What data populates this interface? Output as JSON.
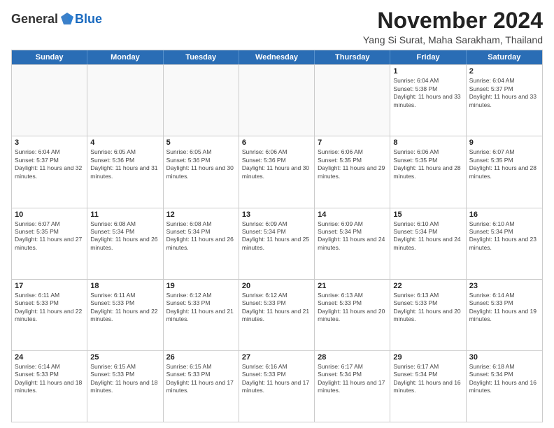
{
  "logo": {
    "general": "General",
    "blue": "Blue"
  },
  "title": "November 2024",
  "subtitle": "Yang Si Surat, Maha Sarakham, Thailand",
  "header_days": [
    "Sunday",
    "Monday",
    "Tuesday",
    "Wednesday",
    "Thursday",
    "Friday",
    "Saturday"
  ],
  "weeks": [
    [
      {
        "day": "",
        "empty": true
      },
      {
        "day": "",
        "empty": true
      },
      {
        "day": "",
        "empty": true
      },
      {
        "day": "",
        "empty": true
      },
      {
        "day": "",
        "empty": true
      },
      {
        "day": "1",
        "sunrise": "Sunrise: 6:04 AM",
        "sunset": "Sunset: 5:38 PM",
        "daylight": "Daylight: 11 hours and 33 minutes."
      },
      {
        "day": "2",
        "sunrise": "Sunrise: 6:04 AM",
        "sunset": "Sunset: 5:37 PM",
        "daylight": "Daylight: 11 hours and 33 minutes."
      }
    ],
    [
      {
        "day": "3",
        "sunrise": "Sunrise: 6:04 AM",
        "sunset": "Sunset: 5:37 PM",
        "daylight": "Daylight: 11 hours and 32 minutes."
      },
      {
        "day": "4",
        "sunrise": "Sunrise: 6:05 AM",
        "sunset": "Sunset: 5:36 PM",
        "daylight": "Daylight: 11 hours and 31 minutes."
      },
      {
        "day": "5",
        "sunrise": "Sunrise: 6:05 AM",
        "sunset": "Sunset: 5:36 PM",
        "daylight": "Daylight: 11 hours and 30 minutes."
      },
      {
        "day": "6",
        "sunrise": "Sunrise: 6:06 AM",
        "sunset": "Sunset: 5:36 PM",
        "daylight": "Daylight: 11 hours and 30 minutes."
      },
      {
        "day": "7",
        "sunrise": "Sunrise: 6:06 AM",
        "sunset": "Sunset: 5:35 PM",
        "daylight": "Daylight: 11 hours and 29 minutes."
      },
      {
        "day": "8",
        "sunrise": "Sunrise: 6:06 AM",
        "sunset": "Sunset: 5:35 PM",
        "daylight": "Daylight: 11 hours and 28 minutes."
      },
      {
        "day": "9",
        "sunrise": "Sunrise: 6:07 AM",
        "sunset": "Sunset: 5:35 PM",
        "daylight": "Daylight: 11 hours and 28 minutes."
      }
    ],
    [
      {
        "day": "10",
        "sunrise": "Sunrise: 6:07 AM",
        "sunset": "Sunset: 5:35 PM",
        "daylight": "Daylight: 11 hours and 27 minutes."
      },
      {
        "day": "11",
        "sunrise": "Sunrise: 6:08 AM",
        "sunset": "Sunset: 5:34 PM",
        "daylight": "Daylight: 11 hours and 26 minutes."
      },
      {
        "day": "12",
        "sunrise": "Sunrise: 6:08 AM",
        "sunset": "Sunset: 5:34 PM",
        "daylight": "Daylight: 11 hours and 26 minutes."
      },
      {
        "day": "13",
        "sunrise": "Sunrise: 6:09 AM",
        "sunset": "Sunset: 5:34 PM",
        "daylight": "Daylight: 11 hours and 25 minutes."
      },
      {
        "day": "14",
        "sunrise": "Sunrise: 6:09 AM",
        "sunset": "Sunset: 5:34 PM",
        "daylight": "Daylight: 11 hours and 24 minutes."
      },
      {
        "day": "15",
        "sunrise": "Sunrise: 6:10 AM",
        "sunset": "Sunset: 5:34 PM",
        "daylight": "Daylight: 11 hours and 24 minutes."
      },
      {
        "day": "16",
        "sunrise": "Sunrise: 6:10 AM",
        "sunset": "Sunset: 5:34 PM",
        "daylight": "Daylight: 11 hours and 23 minutes."
      }
    ],
    [
      {
        "day": "17",
        "sunrise": "Sunrise: 6:11 AM",
        "sunset": "Sunset: 5:33 PM",
        "daylight": "Daylight: 11 hours and 22 minutes."
      },
      {
        "day": "18",
        "sunrise": "Sunrise: 6:11 AM",
        "sunset": "Sunset: 5:33 PM",
        "daylight": "Daylight: 11 hours and 22 minutes."
      },
      {
        "day": "19",
        "sunrise": "Sunrise: 6:12 AM",
        "sunset": "Sunset: 5:33 PM",
        "daylight": "Daylight: 11 hours and 21 minutes."
      },
      {
        "day": "20",
        "sunrise": "Sunrise: 6:12 AM",
        "sunset": "Sunset: 5:33 PM",
        "daylight": "Daylight: 11 hours and 21 minutes."
      },
      {
        "day": "21",
        "sunrise": "Sunrise: 6:13 AM",
        "sunset": "Sunset: 5:33 PM",
        "daylight": "Daylight: 11 hours and 20 minutes."
      },
      {
        "day": "22",
        "sunrise": "Sunrise: 6:13 AM",
        "sunset": "Sunset: 5:33 PM",
        "daylight": "Daylight: 11 hours and 20 minutes."
      },
      {
        "day": "23",
        "sunrise": "Sunrise: 6:14 AM",
        "sunset": "Sunset: 5:33 PM",
        "daylight": "Daylight: 11 hours and 19 minutes."
      }
    ],
    [
      {
        "day": "24",
        "sunrise": "Sunrise: 6:14 AM",
        "sunset": "Sunset: 5:33 PM",
        "daylight": "Daylight: 11 hours and 18 minutes."
      },
      {
        "day": "25",
        "sunrise": "Sunrise: 6:15 AM",
        "sunset": "Sunset: 5:33 PM",
        "daylight": "Daylight: 11 hours and 18 minutes."
      },
      {
        "day": "26",
        "sunrise": "Sunrise: 6:15 AM",
        "sunset": "Sunset: 5:33 PM",
        "daylight": "Daylight: 11 hours and 17 minutes."
      },
      {
        "day": "27",
        "sunrise": "Sunrise: 6:16 AM",
        "sunset": "Sunset: 5:33 PM",
        "daylight": "Daylight: 11 hours and 17 minutes."
      },
      {
        "day": "28",
        "sunrise": "Sunrise: 6:17 AM",
        "sunset": "Sunset: 5:34 PM",
        "daylight": "Daylight: 11 hours and 17 minutes."
      },
      {
        "day": "29",
        "sunrise": "Sunrise: 6:17 AM",
        "sunset": "Sunset: 5:34 PM",
        "daylight": "Daylight: 11 hours and 16 minutes."
      },
      {
        "day": "30",
        "sunrise": "Sunrise: 6:18 AM",
        "sunset": "Sunset: 5:34 PM",
        "daylight": "Daylight: 11 hours and 16 minutes."
      }
    ]
  ]
}
